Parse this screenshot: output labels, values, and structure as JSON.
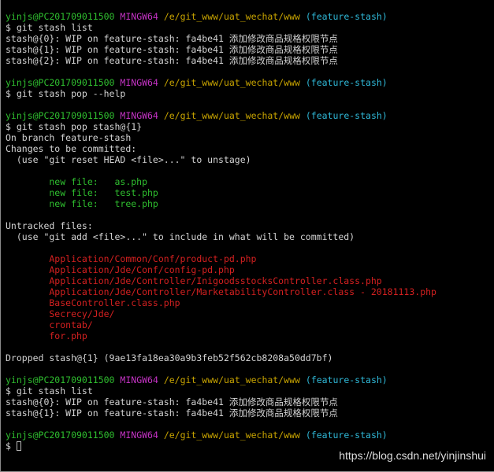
{
  "colors": {
    "background": "#000000",
    "text": "#d3d3d3",
    "prompt_user": "#2fbf2f",
    "prompt_msys": "#c533c5",
    "prompt_path": "#c8a400",
    "prompt_branch": "#2fb7d6",
    "staged": "#2fbf2f",
    "untracked": "#d42020"
  },
  "prompt": {
    "user_host": "yinjs@PC201709011500",
    "msys": "MINGW64",
    "path": "/e/git_www/uat_wechat/www",
    "branch": "(feature-stash)"
  },
  "blocks": [
    {
      "command": "$ git stash list",
      "output": [
        "stash@{0}: WIP on feature-stash: fa4be41 添加修改商品规格权限节点",
        "stash@{1}: WIP on feature-stash: fa4be41 添加修改商品规格权限节点",
        "stash@{2}: WIP on feature-stash: fa4be41 添加修改商品规格权限节点"
      ]
    },
    {
      "command": "$ git stash pop --help",
      "output": []
    },
    {
      "command": "$ git stash pop stash@{1}",
      "output": [
        "On branch feature-stash",
        "Changes to be committed:",
        "  (use \"git reset HEAD <file>...\" to unstage)"
      ],
      "staged_files": [
        "        new file:   as.php",
        "        new file:   test.php",
        "        new file:   tree.php"
      ],
      "untracked_header": [
        "Untracked files:",
        "  (use \"git add <file>...\" to include in what will be committed)"
      ],
      "untracked_files": [
        "        Application/Common/Conf/product-pd.php",
        "        Application/Jde/Conf/config-pd.php",
        "        Application/Jde/Controller/InigoodsstocksController.class.php",
        "        Application/Jde/Controller/MarketabilityController.class - 20181113.php",
        "        BaseController.class.php",
        "        Secrecy/Jde/",
        "        crontab/",
        "        for.php"
      ],
      "dropped": "Dropped stash@{1} (9ae13fa18ea30a9b3feb52f562cb8208a50dd7bf)"
    },
    {
      "command": "$ git stash list",
      "output": [
        "stash@{0}: WIP on feature-stash: fa4be41 添加修改商品规格权限节点",
        "stash@{1}: WIP on feature-stash: fa4be41 添加修改商品规格权限节点"
      ]
    }
  ],
  "final_prompt_symbol": "$ ",
  "watermark": "https://blog.csdn.net/yinjinshui"
}
